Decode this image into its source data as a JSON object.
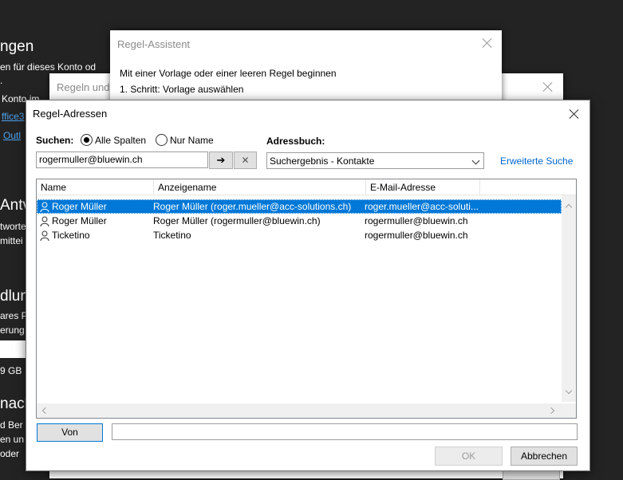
{
  "background": {
    "lines": [
      "ngen",
      "en für dieses Konto od",
      ".",
      "Konto im",
      "ffice3",
      "Outl",
      "Antv",
      "tworte",
      "mittei",
      "dlung",
      "ares P",
      "erung",
      "9 GB",
      "nacl",
      "d Ber",
      "en un",
      "oder"
    ]
  },
  "assistent": {
    "title": "Regel-Assistent",
    "line1": "Mit einer Vorlage oder einer leeren Regel beginnen",
    "line2": "1. Schritt: Vorlage auswählen"
  },
  "regeln": {
    "title": "Regeln und"
  },
  "dialog": {
    "title": "Regel-Adressen",
    "search_label": "Suchen:",
    "radio_all": "Alle Spalten",
    "radio_name": "Nur Name",
    "addressbook_label": "Adressbuch:",
    "search_value": "rogermuller@bluewin.ch",
    "go_glyph": "➔",
    "clear_glyph": "✕",
    "addressbook_value": "Suchergebnis - Kontakte",
    "advanced_search": "Erweiterte Suche",
    "columns": [
      "Name",
      "Anzeigename",
      "E-Mail-Adresse"
    ],
    "rows": [
      {
        "name": "Roger Müller",
        "display": "Roger Müller (roger.mueller@acc-solutions.ch)",
        "email": "roger.mueller@acc-soluti..."
      },
      {
        "name": "Roger Müller",
        "display": "Roger Müller (rogermuller@bluewin.ch)",
        "email": "rogermuller@bluewin.ch"
      },
      {
        "name": "Ticketino",
        "display": "Ticketino",
        "email": "rogermuller@bluewin.ch"
      }
    ],
    "from_button": "Von",
    "from_value": "",
    "ok_button": "OK",
    "cancel_button": "Abbrechen"
  }
}
